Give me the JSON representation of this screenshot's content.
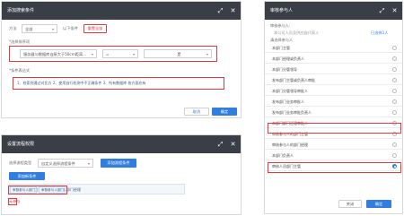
{
  "panel_top_left": {
    "title": "添加搜索条件",
    "fields": {
      "scope_label": "方法",
      "scope_value": "全部",
      "match_label": "以下条件",
      "reset_label": "重置全部"
    },
    "condition_group_label": "*选择排序项",
    "condition": {
      "field_value": "服务器与数据库连接大于50cm距离...",
      "operator_value": "=",
      "unit_value": "是"
    },
    "expression_label": "*条件表达式",
    "expression_text": "1、检索到通过对比方 2、使用自行检测中不正确条件 3、所有数据库 各方面应有",
    "cancel_label": "取消",
    "ok_label": "确定"
  },
  "panel_right": {
    "title": "审核参与人",
    "header_label": "审核参与人:",
    "hint_text": "本公司人员及供应链代表人",
    "selected_count": "已选择1人",
    "section_label": "请选择参与人",
    "items": [
      {
        "label": "本部门主管",
        "selected": false
      },
      {
        "label": "本部门经理或负责人",
        "selected": false
      },
      {
        "label": "本部门分管领导",
        "selected": false
      },
      {
        "label": "发布部门主管或负责人审批",
        "selected": false
      },
      {
        "label": "本部门分管领导审批人",
        "selected": false
      },
      {
        "label": "发布部门业务审批人",
        "selected": false
      },
      {
        "label": "发布部门业务审批负责人",
        "selected": false
      },
      {
        "label": "本部门部门经理审批人",
        "selected": false
      },
      {
        "label": "审核参与人的部门主管",
        "selected": false
      },
      {
        "label": "审核参与人的部门经理",
        "selected": false
      },
      {
        "label": "本部门负责人",
        "selected": false
      },
      {
        "label": "审核人员部门主管",
        "selected": true
      }
    ],
    "close_label": "关闭",
    "ok_label": "确定"
  },
  "panel_bottom_left": {
    "title": "设置流程权限",
    "fields": {
      "flow_label": "选择流程类型",
      "flow_value": "自定义选择流程条件",
      "action_label": "添加流程条件"
    },
    "add_button_label": "添加新条件",
    "condition_text": "审核参与人部门主管、审核参与人部门经理",
    "tags": [
      "审核参与人部门主管",
      "审核参与人部门经理"
    ],
    "footer_text": "无参与"
  }
}
